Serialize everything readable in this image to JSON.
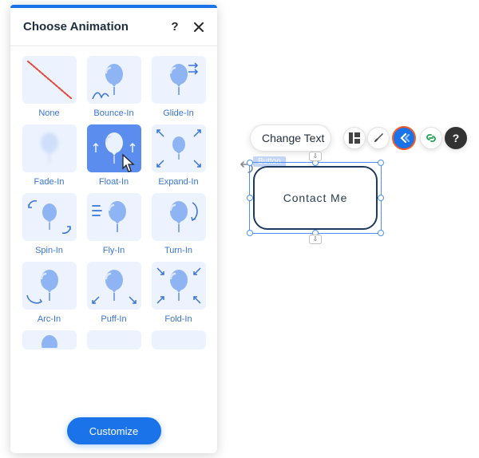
{
  "panel": {
    "title": "Choose Animation",
    "customize_label": "Customize",
    "options": [
      {
        "label": "None",
        "kind": "none"
      },
      {
        "label": "Bounce-In",
        "kind": "bounce"
      },
      {
        "label": "Glide-In",
        "kind": "glide"
      },
      {
        "label": "Fade-In",
        "kind": "fade"
      },
      {
        "label": "Float-In",
        "kind": "float",
        "selected": true
      },
      {
        "label": "Expand-In",
        "kind": "expand"
      },
      {
        "label": "Spin-In",
        "kind": "spin"
      },
      {
        "label": "Fly-In",
        "kind": "fly"
      },
      {
        "label": "Turn-In",
        "kind": "turn"
      },
      {
        "label": "Arc-In",
        "kind": "arc"
      },
      {
        "label": "Puff-In",
        "kind": "puff"
      },
      {
        "label": "Fold-In",
        "kind": "fold"
      }
    ]
  },
  "toolbar": {
    "change_text_label": "Change Text"
  },
  "canvas_element": {
    "type_tag": "Button",
    "text": "Contact Me"
  }
}
